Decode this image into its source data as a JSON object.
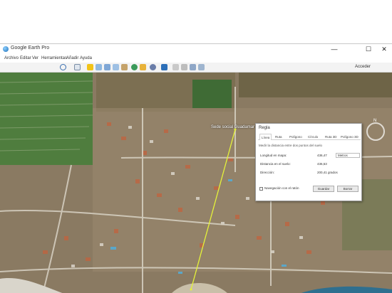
{
  "window": {
    "title": "Google Earth Pro",
    "minimize": "—",
    "maximize": "☐",
    "close": "✕"
  },
  "menu": [
    "Archivo",
    "Editar",
    "Ver",
    "Herramientas",
    "Añadir",
    "Ayuda"
  ],
  "toolbar": {
    "sign_in": "Acceder",
    "icons": [
      "hide-sidebar-icon",
      "placemark-icon",
      "polygon-icon",
      "path-icon",
      "overlay-icon",
      "tour-icon",
      "history-icon",
      "sun-icon",
      "planets-icon",
      "ruler-icon",
      "email-icon",
      "print-icon",
      "save-image-icon",
      "maps-icon"
    ]
  },
  "map": {
    "placemark_label": "Sede social Guadamar"
  },
  "ruler_dialog": {
    "title": "Regla",
    "tabs": [
      "Línea",
      "Ruta",
      "Polígono",
      "Círculo",
      "Ruta 3D",
      "Polígono 3D"
    ],
    "active_tab": "Línea",
    "description": "Medir la distancia entre dos puntos del suelo",
    "rows": [
      {
        "label": "Longitud en mapa:",
        "value": "436,47",
        "unit": "Metros"
      },
      {
        "label": "Distancia en el suelo:",
        "value": "436,53",
        "unit": ""
      },
      {
        "label": "Dirección:",
        "value": "200,41 grados",
        "unit": ""
      }
    ],
    "mouse_nav_label": "Navegación con el ratón",
    "save_button": "Guardar",
    "clear_button": "Borrar"
  },
  "compass": {
    "north": "N"
  },
  "colors": {
    "ruler_line": "#e5f23a",
    "window_bg": "#f0f0f0"
  }
}
